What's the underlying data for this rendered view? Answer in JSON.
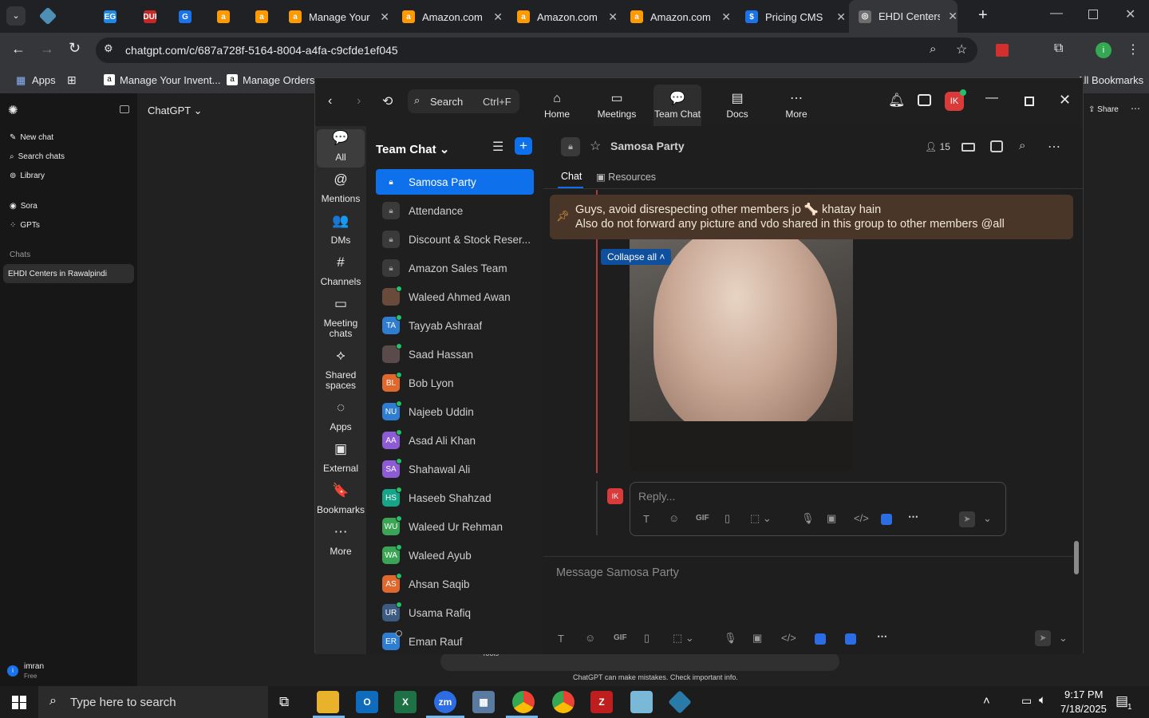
{
  "browser": {
    "tabs": [
      {
        "title": "",
        "fav": "EG",
        "color": "#1e88e5"
      },
      {
        "title": "",
        "fav": "DUI",
        "color": "#c62828"
      },
      {
        "title": "",
        "fav": "G",
        "color": "#1a73e8"
      },
      {
        "title": "",
        "fav": "a",
        "color": "#ff9900"
      },
      {
        "title": "",
        "fav": "a",
        "color": "#ff9900"
      },
      {
        "title": "Manage Your",
        "fav": "a",
        "color": "#ff9900"
      },
      {
        "title": "Amazon.com",
        "fav": "a",
        "color": "#ff9900"
      },
      {
        "title": "Amazon.com",
        "fav": "a",
        "color": "#ff9900"
      },
      {
        "title": "Amazon.com",
        "fav": "a",
        "color": "#ff9900"
      },
      {
        "title": "Pricing CMS",
        "fav": "$",
        "color": "#1a73e8"
      },
      {
        "title": "EHDI Centers",
        "fav": "◎",
        "color": "#6d6d6d"
      }
    ],
    "url": "chatgpt.com/c/687a728f-5164-8004-a4fa-c9cfde1ef045",
    "bookmarks": {
      "apps": "Apps",
      "b1": "Manage Your Invent...",
      "b2": "Manage Orders",
      "all": "All Bookmarks"
    }
  },
  "chatgpt": {
    "title": "ChatGPT",
    "new_chat": "New chat",
    "search_chats": "Search chats",
    "library": "Library",
    "sora": "Sora",
    "gpts": "GPTs",
    "chats_header": "Chats",
    "active_chat": "EHDI Centers in Rawalpindi",
    "user_name": "imran",
    "user_plan": "Free",
    "share": "Share",
    "disclaimer": "ChatGPT can make mistakes. Check important info.",
    "tools": "Tools"
  },
  "zoom": {
    "search_label": "Search",
    "search_shortcut": "Ctrl+F",
    "nav": [
      {
        "label": "Home",
        "icon": "⌂"
      },
      {
        "label": "Meetings",
        "icon": "▭"
      },
      {
        "label": "Team Chat",
        "icon": "💬"
      },
      {
        "label": "Docs",
        "icon": "▤"
      },
      {
        "label": "More",
        "icon": "⋯"
      }
    ],
    "user_initials": "IK",
    "left": [
      {
        "label": "All",
        "icon": "💬"
      },
      {
        "label": "Mentions",
        "icon": "@"
      },
      {
        "label": "DMs",
        "icon": "👥"
      },
      {
        "label": "Channels",
        "icon": "#"
      },
      {
        "label": "Meeting chats",
        "icon": "▭"
      },
      {
        "label": "Shared spaces",
        "icon": "⟡"
      },
      {
        "label": "Apps",
        "icon": "◌"
      },
      {
        "label": "External",
        "icon": "▣"
      },
      {
        "label": "Bookmarks",
        "icon": "🔖"
      },
      {
        "label": "More",
        "icon": "⋯"
      }
    ],
    "list_title": "Team Chat",
    "contacts": [
      {
        "name": "Samosa Party",
        "type": "channel"
      },
      {
        "name": "Attendance",
        "type": "channel"
      },
      {
        "name": "Discount & Stock Reser...",
        "type": "channel"
      },
      {
        "name": "Amazon Sales Team",
        "type": "channel"
      },
      {
        "name": "Waleed Ahmed Awan",
        "initials": "",
        "color": "#6a4a3a"
      },
      {
        "name": "Tayyab Ashraaf",
        "initials": "TA",
        "color": "#2e7dd1"
      },
      {
        "name": "Saad Hassan",
        "initials": "",
        "color": "#5a4a4a"
      },
      {
        "name": "Bob Lyon",
        "initials": "BL",
        "color": "#e0682c"
      },
      {
        "name": "Najeeb Uddin",
        "initials": "NU",
        "color": "#2e7dd1"
      },
      {
        "name": "Asad Ali Khan",
        "initials": "AA",
        "color": "#8e5bd6"
      },
      {
        "name": "Shahawal Ali",
        "initials": "SA",
        "color": "#8e5bd6"
      },
      {
        "name": "Haseeb Shahzad",
        "initials": "HS",
        "color": "#17a589"
      },
      {
        "name": "Waleed Ur Rehman",
        "initials": "WU",
        "color": "#3aa655"
      },
      {
        "name": "Waleed Ayub",
        "initials": "WA",
        "color": "#3aa655"
      },
      {
        "name": "Ahsan Saqib",
        "initials": "AS",
        "color": "#e0682c"
      },
      {
        "name": "Usama Rafiq",
        "initials": "UR",
        "color": "#3d5a80"
      },
      {
        "name": "Eman Rauf",
        "initials": "ER",
        "color": "#2e7dd1"
      }
    ],
    "channel_name": "Samosa Party",
    "member_count": "15",
    "tab_chat": "Chat",
    "tab_resources": "Resources",
    "pinned_line1": "Guys, avoid disrespecting other members jo 🦴 khatay hain",
    "pinned_line2": "Also do not forward any picture and vdo shared in this group to other members @all",
    "collapse_all": "Collapse all",
    "reply_placeholder": "Reply...",
    "reply_avatar": "IK",
    "message_placeholder": "Message Samosa Party",
    "gif": "GIF"
  },
  "taskbar": {
    "search": "Type here to search",
    "time": "9:17 PM",
    "date": "7/18/2025",
    "notif": "1"
  }
}
